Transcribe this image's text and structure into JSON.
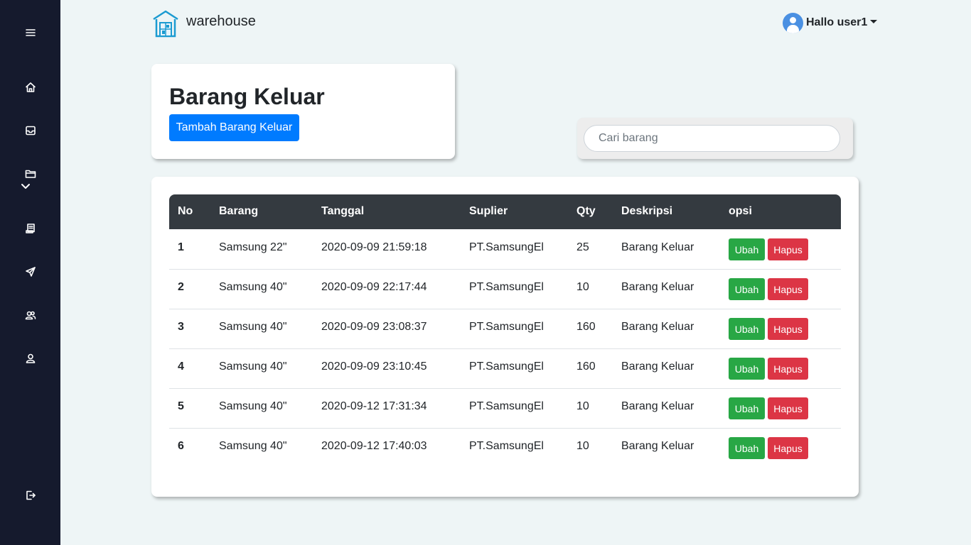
{
  "sidebar": {
    "items": [
      {
        "icon": "menu-icon"
      },
      {
        "icon": "home-icon"
      },
      {
        "icon": "inbox-icon"
      },
      {
        "icon": "folder-icon"
      },
      {
        "icon": "receipt-icon"
      },
      {
        "icon": "send-icon"
      },
      {
        "icon": "users-icon"
      },
      {
        "icon": "user-icon"
      },
      {
        "icon": "logout-icon"
      }
    ],
    "color": "#151a2d"
  },
  "brand": {
    "name": "warehouse",
    "icon": "warehouse-icon",
    "color": "#1b9bd1"
  },
  "user": {
    "greeting": "Hallo user1"
  },
  "page": {
    "title": "Barang Keluar",
    "add_button": "Tambah Barang Keluar"
  },
  "search": {
    "placeholder": "Cari barang",
    "value": ""
  },
  "table": {
    "columns": [
      "No",
      "Barang",
      "Tanggal",
      "Suplier",
      "Qty",
      "Deskripsi",
      "opsi"
    ],
    "rows": [
      {
        "no": "1",
        "barang": "Samsung 22\"",
        "tanggal": "2020-09-09 21:59:18",
        "suplier": "PT.SamsungEl",
        "qty": "25",
        "deskripsi": "Barang Keluar"
      },
      {
        "no": "2",
        "barang": "Samsung 40\"",
        "tanggal": "2020-09-09 22:17:44",
        "suplier": "PT.SamsungEl",
        "qty": "10",
        "deskripsi": "Barang Keluar"
      },
      {
        "no": "3",
        "barang": "Samsung 40\"",
        "tanggal": "2020-09-09 23:08:37",
        "suplier": "PT.SamsungEl",
        "qty": "160",
        "deskripsi": "Barang Keluar"
      },
      {
        "no": "4",
        "barang": "Samsung 40\"",
        "tanggal": "2020-09-09 23:10:45",
        "suplier": "PT.SamsungEl",
        "qty": "160",
        "deskripsi": "Barang Keluar"
      },
      {
        "no": "5",
        "barang": "Samsung 40\"",
        "tanggal": "2020-09-12 17:31:34",
        "suplier": "PT.SamsungEl",
        "qty": "10",
        "deskripsi": "Barang Keluar"
      },
      {
        "no": "6",
        "barang": "Samsung 40\"",
        "tanggal": "2020-09-12 17:40:03",
        "suplier": "PT.SamsungEl",
        "qty": "10",
        "deskripsi": "Barang Keluar"
      }
    ],
    "edit_label": "Ubah",
    "delete_label": "Hapus",
    "header_color": "#343a40"
  },
  "colors": {
    "primary": "#007bff",
    "success": "#28a745",
    "danger": "#dc3545",
    "background": "#eef5f6"
  }
}
